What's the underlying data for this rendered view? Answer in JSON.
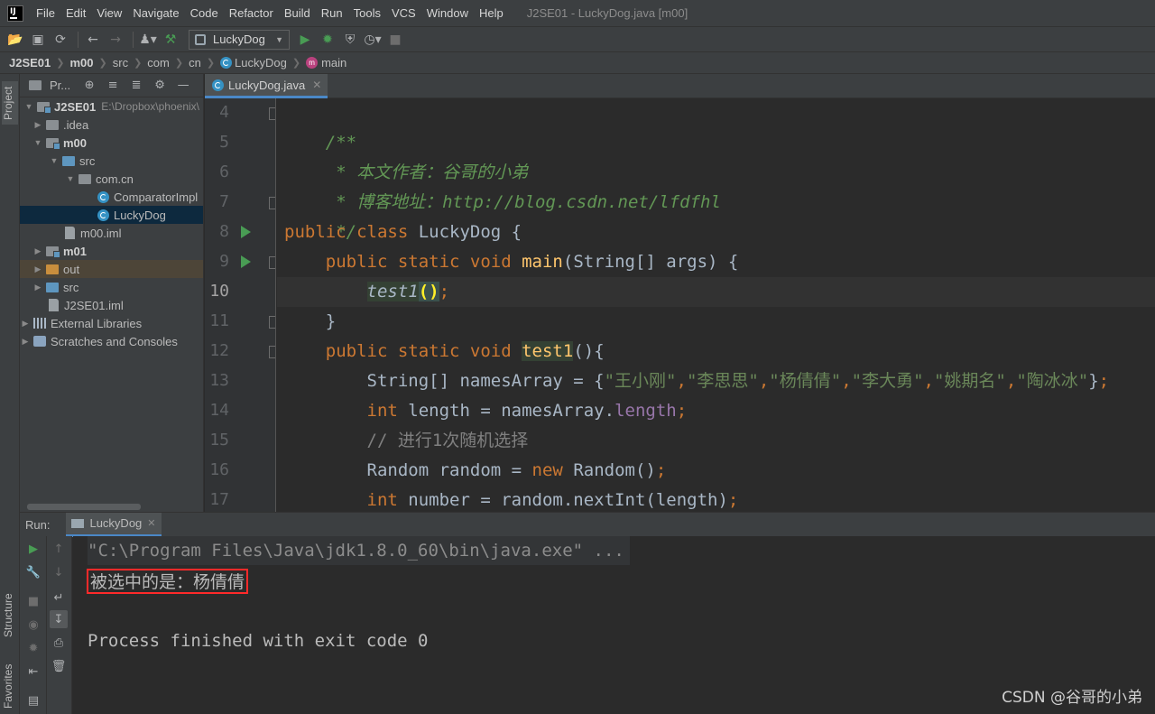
{
  "menu": {
    "items": [
      "File",
      "Edit",
      "View",
      "Navigate",
      "Code",
      "Refactor",
      "Build",
      "Run",
      "Tools",
      "VCS",
      "Window",
      "Help"
    ],
    "window_title": "J2SE01 - LuckyDog.java [m00]"
  },
  "toolbar": {
    "run_config": "LuckyDog"
  },
  "breadcrumb": [
    "J2SE01",
    "m00",
    "src",
    "com",
    "cn",
    "LuckyDog",
    "main"
  ],
  "side_tabs": {
    "project": "Project",
    "structure": "Structure",
    "favorites": "Favorites"
  },
  "project_panel": {
    "title": "Pr...",
    "root_name": "J2SE01",
    "root_path": "E:\\Dropbox\\phoenix\\",
    "tree": {
      "idea": ".idea",
      "m00": "m00",
      "src": "src",
      "pkg": "com.cn",
      "comparator": "ComparatorImpl",
      "luckydog": "LuckyDog",
      "m00iml": "m00.iml",
      "m01": "m01",
      "out": "out",
      "src2": "src",
      "j2seiml": "J2SE01.iml",
      "libs": "External Libraries",
      "scratches": "Scratches and Consoles"
    }
  },
  "editor": {
    "tab": "LuckyDog.java",
    "line_numbers": [
      "4",
      "5",
      "6",
      "7",
      "8",
      "9",
      "10",
      "11",
      "12",
      "13",
      "14",
      "15",
      "16",
      "17"
    ],
    "current_line": "10",
    "code": {
      "l4": "/**",
      "l5": " * 本文作者：谷哥的小弟",
      "l6": " * 博客地址：http://blog.csdn.net/lfdfhl",
      "l7": " */",
      "l8_kw": "public class ",
      "l8_name": "LuckyDog {",
      "l9_kw": "    public static void ",
      "l9_fn": "main",
      "l9_rest": "(String[] args) {",
      "l10_indent": "        ",
      "l10_call": "test1",
      "l10_paren": "()",
      "l10_semi": ";",
      "l11": "    }",
      "l12_kw": "    public static void ",
      "l12_fn": "test1",
      "l12_rest": "(){",
      "l13_a": "        String[] namesArray = {",
      "l13_s1": "\"王小刚\"",
      "l13_s2": "\"李思思\"",
      "l13_s3": "\"杨倩倩\"",
      "l13_s4": "\"李大勇\"",
      "l13_s5": "\"姚期名\"",
      "l13_s6": "\"陶冰冰\"",
      "l13_comma": ",",
      "l13_end": "}",
      "l13_semi": ";",
      "l14_kw": "        int ",
      "l14_a": "length = namesArray.",
      "l14_field": "length",
      "l14_semi": ";",
      "l15": "        // 进行1次随机选择",
      "l16_a": "        Random random = ",
      "l16_kw": "new ",
      "l16_b": "Random()",
      "l16_semi": ";",
      "l17_kw": "        int ",
      "l17_a": "number = random.nextInt(length)",
      "l17_semi": ";"
    }
  },
  "run_panel": {
    "label": "Run:",
    "tab": "LuckyDog",
    "console": {
      "command": "\"C:\\Program Files\\Java\\jdk1.8.0_60\\bin\\java.exe\" ...",
      "output": "被选中的是：杨倩倩",
      "exit": "Process finished with exit code 0"
    }
  },
  "watermark": "CSDN @谷哥的小弟",
  "colors": {
    "keyword": "#cc7832",
    "doc_comment": "#629755",
    "string": "#6a8759",
    "method": "#ffc66d",
    "field": "#9876aa",
    "highlight_box": "#ff2a2a"
  }
}
